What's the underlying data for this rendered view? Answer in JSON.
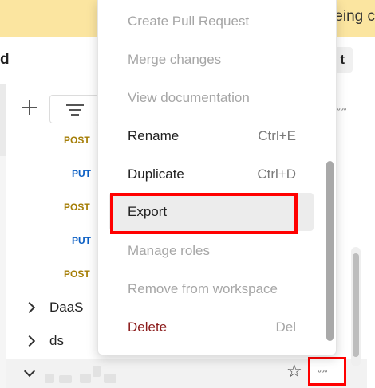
{
  "banner": {
    "text": "eing c"
  },
  "header": {
    "left_text": "d",
    "right_button": "t"
  },
  "sidebar": {
    "requests": [
      {
        "method": "POST"
      },
      {
        "method": "PUT"
      },
      {
        "method": "POST"
      },
      {
        "method": "PUT"
      },
      {
        "method": "POST"
      }
    ],
    "folders": [
      {
        "label": "DaaS"
      },
      {
        "label": "ds"
      }
    ]
  },
  "more_glyph": "◦◦◦",
  "star_glyph": "☆",
  "menu": {
    "items": [
      {
        "label": "Create Pull Request",
        "shortcut": "",
        "state": "disabled"
      },
      {
        "label": "Merge changes",
        "shortcut": "",
        "state": "disabled"
      },
      {
        "label": "View documentation",
        "shortcut": "",
        "state": "disabled"
      },
      {
        "label": "Rename",
        "shortcut": "Ctrl+E",
        "state": "enabled"
      },
      {
        "label": "Duplicate",
        "shortcut": "Ctrl+D",
        "state": "enabled"
      },
      {
        "label": "Export",
        "shortcut": "",
        "state": "hover"
      },
      {
        "label": "Manage roles",
        "shortcut": "",
        "state": "disabled"
      },
      {
        "label": "Remove from workspace",
        "shortcut": "",
        "state": "disabled"
      },
      {
        "label": "Delete",
        "shortcut": "Del",
        "state": "danger"
      }
    ]
  },
  "colors": {
    "banner": "#fbe5a0",
    "post": "#a57e07",
    "put": "#0b5fc4",
    "highlight": "#ff0000",
    "danger": "#8b1a1a"
  }
}
